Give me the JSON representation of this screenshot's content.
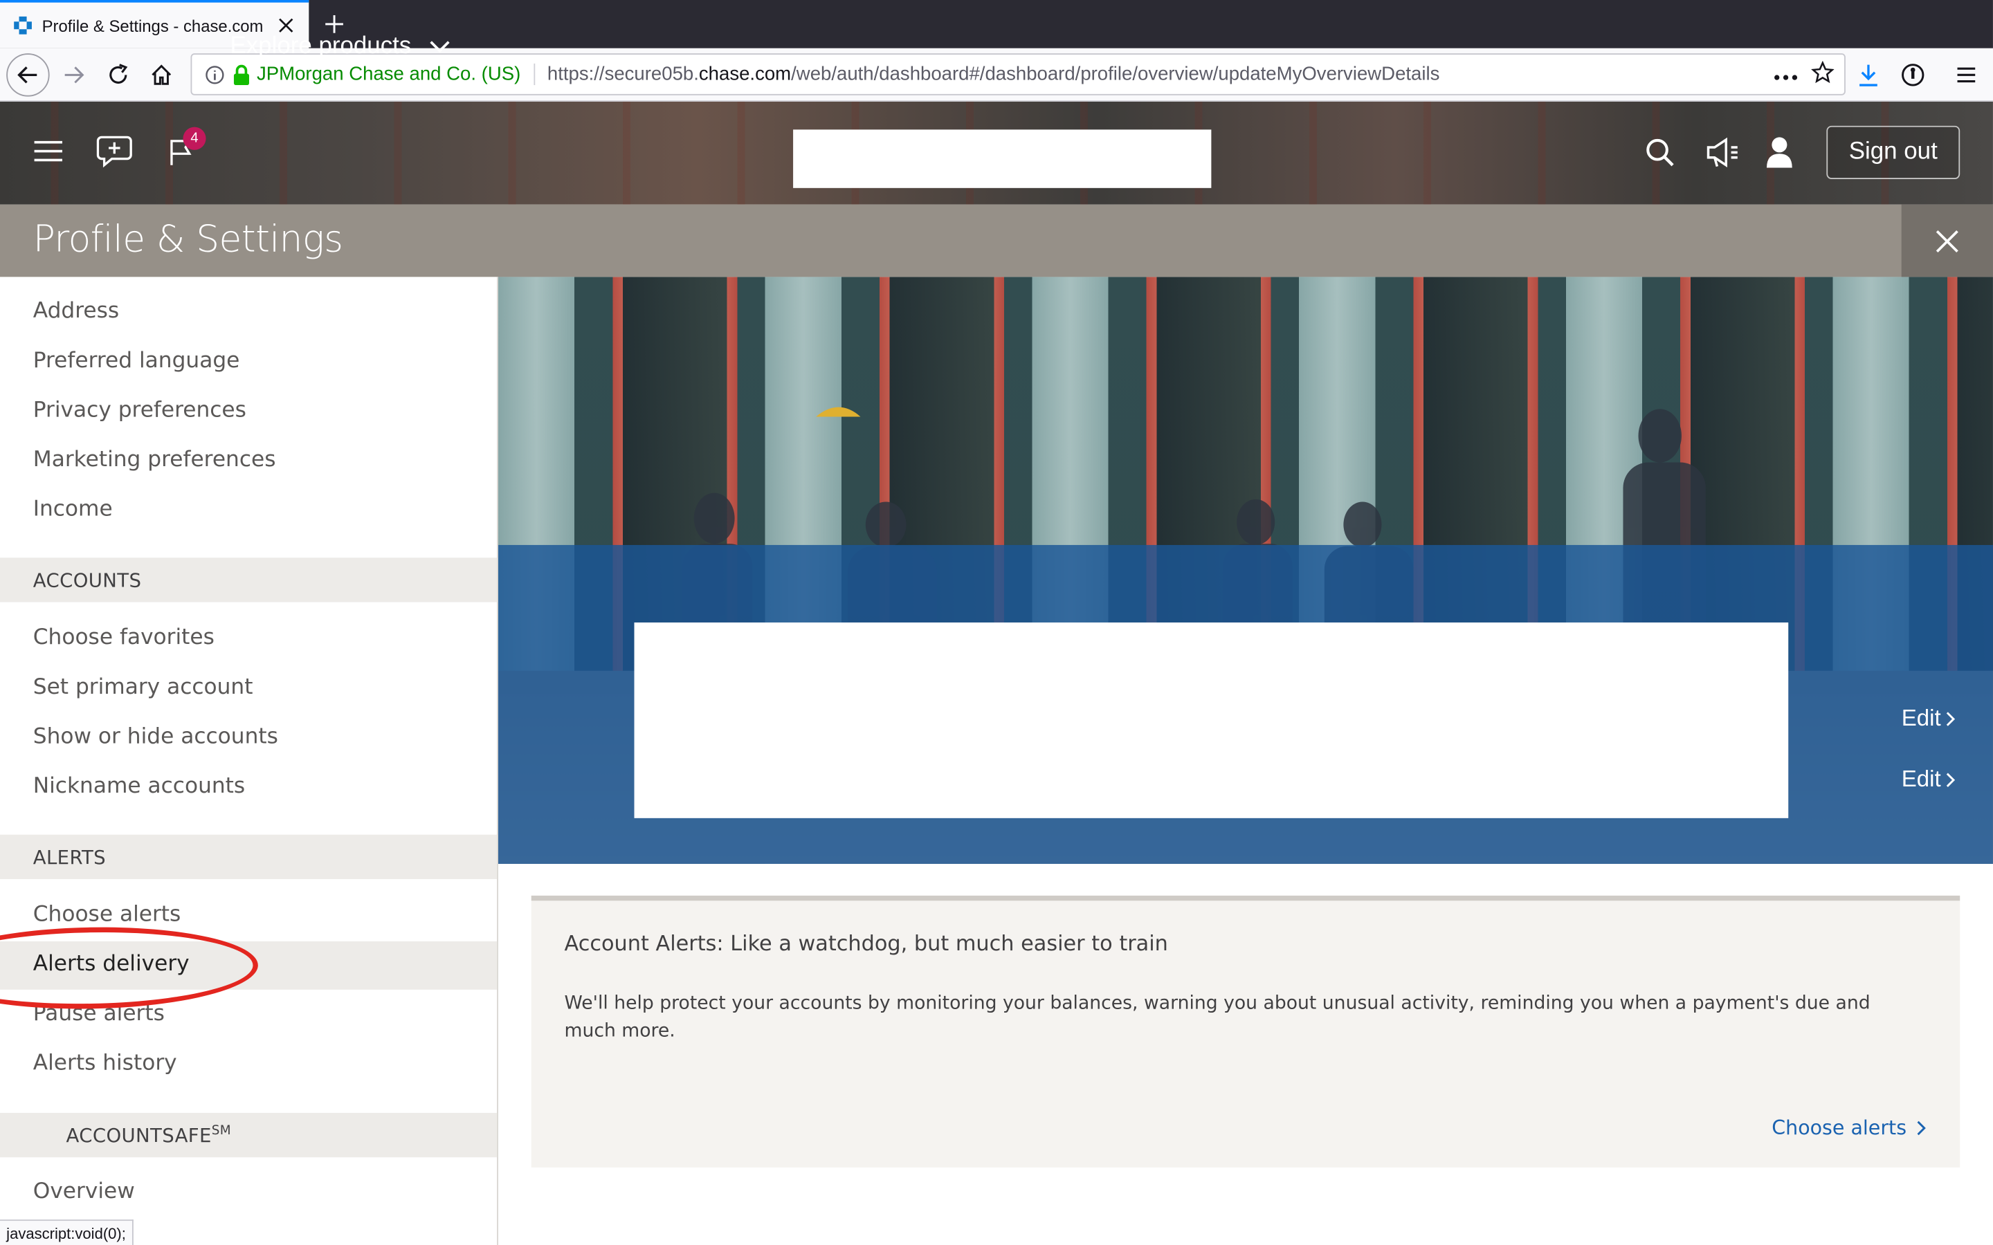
{
  "browser": {
    "tab_title": "Profile & Settings - chase.com",
    "url_org": "JPMorgan Chase and Co. (US)",
    "url_prefix": "https://secure05b.",
    "url_host": "chase.com",
    "url_path": "/web/auth/dashboard#/dashboard/profile/overview/updateMyOverviewDetails",
    "status_text": "javascript:void(0);"
  },
  "header": {
    "explore_label": "Explore products",
    "notification_count": "4",
    "signout_label": "Sign out"
  },
  "page": {
    "title": "Profile & Settings"
  },
  "sidebar": {
    "profile_items": [
      "Address",
      "Preferred language",
      "Privacy preferences",
      "Marketing preferences",
      "Income"
    ],
    "accounts_header": "ACCOUNTS",
    "accounts_items": [
      "Choose favorites",
      "Set primary account",
      "Show or hide accounts",
      "Nickname accounts"
    ],
    "alerts_header": "ALERTS",
    "alerts_items": [
      "Choose alerts",
      "Alerts delivery",
      "Pause alerts",
      "Alerts history"
    ],
    "accountsafe_header": "ACCOUNTSAFE",
    "accountsafe_sup": "SM",
    "accountsafe_items": [
      "Overview"
    ],
    "active_item": "Alerts delivery"
  },
  "hero": {
    "edit_label_1": "Edit",
    "edit_label_2": "Edit"
  },
  "card": {
    "title": "Account Alerts: Like a watchdog, but much easier to train",
    "body": "We'll help protect your accounts by monitoring your balances, warning you about unusual activity, reminding you when a payment's due and much more.",
    "link_label": "Choose alerts"
  },
  "colors": {
    "chase_blue": "#1a62b0",
    "annotation_red": "#e3261f",
    "settings_bar": "#969088"
  }
}
